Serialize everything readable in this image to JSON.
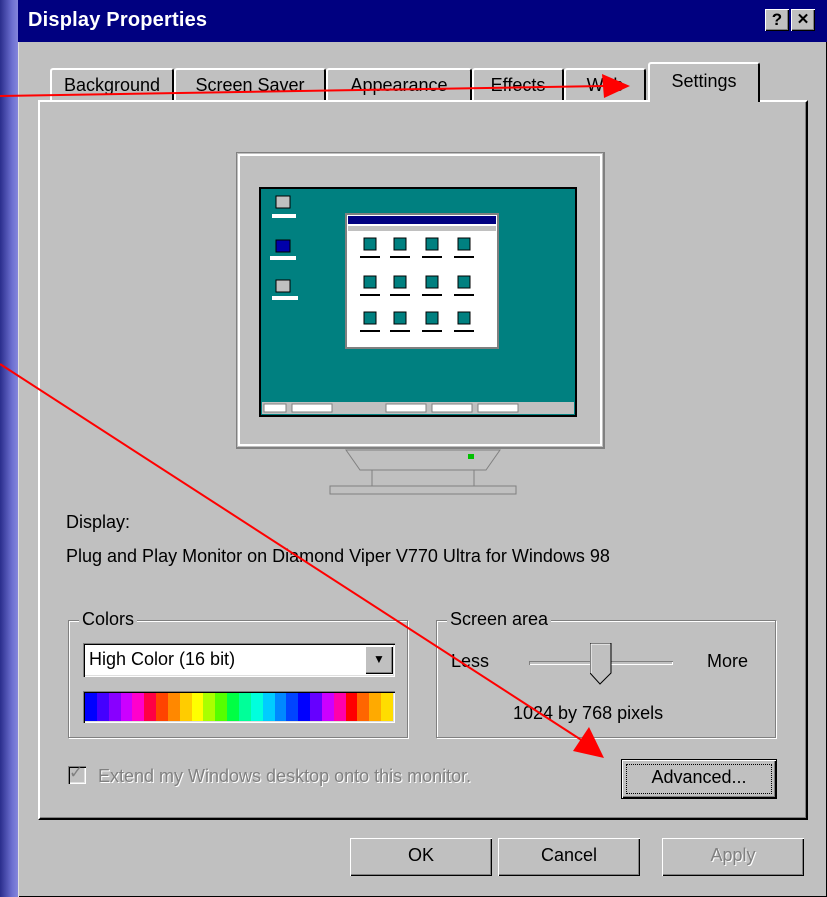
{
  "window": {
    "title": "Display Properties",
    "help_label": "?",
    "close_label": "✕"
  },
  "tabs": [
    {
      "label": "Background"
    },
    {
      "label": "Screen Saver"
    },
    {
      "label": "Appearance"
    },
    {
      "label": "Effects"
    },
    {
      "label": "Web"
    },
    {
      "label": "Settings"
    }
  ],
  "active_tab": "Settings",
  "display": {
    "label": "Display:",
    "device": "Plug and Play Monitor on Diamond Viper V770 Ultra for Windows 98"
  },
  "colors": {
    "group_label": "Colors",
    "selected": "High Color (16 bit)",
    "spectrum": [
      "#0000ff",
      "#4400ff",
      "#8800ff",
      "#cc00ff",
      "#ff00cc",
      "#ff0044",
      "#ff4400",
      "#ff8800",
      "#ffcc00",
      "#ffff00",
      "#aaff00",
      "#55ff00",
      "#00ff44",
      "#00ff99",
      "#00ffdd",
      "#00ccff",
      "#0088ff",
      "#0044ff",
      "#0000ff",
      "#6600ff",
      "#cc00ff",
      "#ff00aa",
      "#ff0000",
      "#ff6600",
      "#ffaa00",
      "#ffdd00"
    ]
  },
  "screen_area": {
    "group_label": "Screen area",
    "less_label": "Less",
    "more_label": "More",
    "resolution_text": "1024 by 768 pixels",
    "slider_position": 0.5
  },
  "extend_checkbox": {
    "label": "Extend my Windows desktop onto this monitor.",
    "checked": true,
    "disabled": true
  },
  "advanced_button": {
    "label": "Advanced..."
  },
  "footer": {
    "ok_label": "OK",
    "cancel_label": "Cancel",
    "apply_label": "Apply"
  },
  "annotation_color": "#ff0000",
  "colors_theme": {
    "titlebar": "#000080",
    "face": "#c0c0c0",
    "desktop": "#008080"
  }
}
